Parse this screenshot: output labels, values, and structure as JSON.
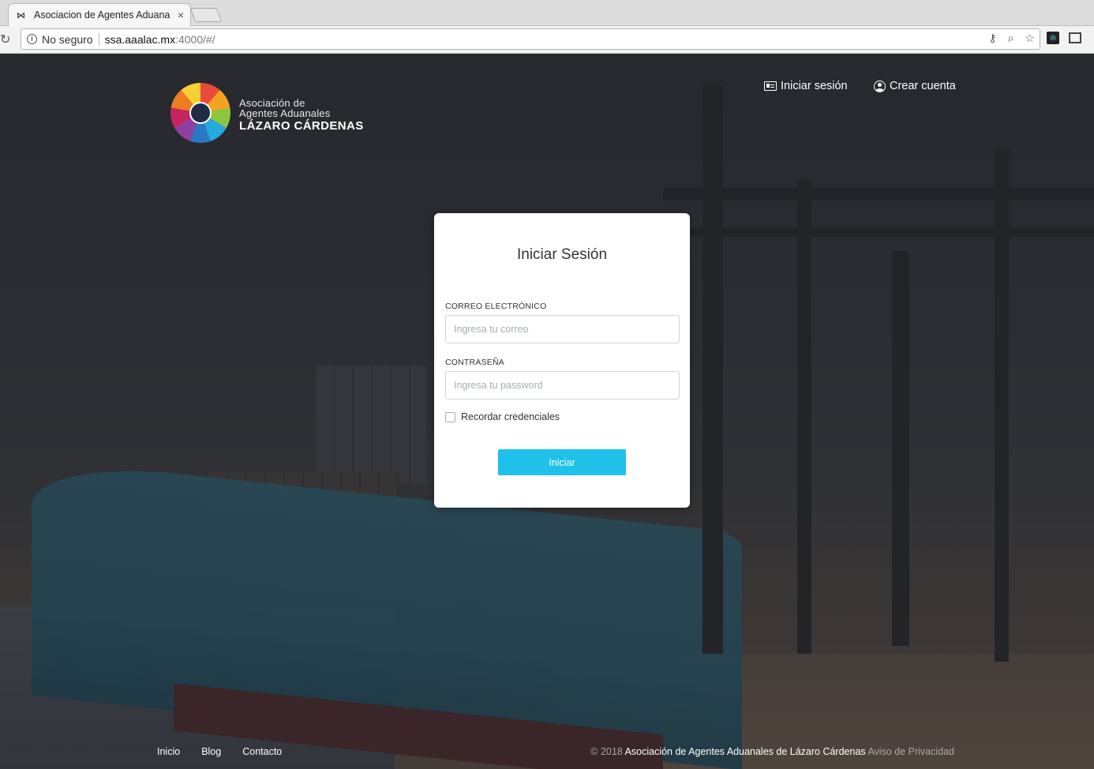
{
  "browser": {
    "tab_title": "Asociacion de Agentes Aduana",
    "tab_favicon": "bowtie-icon",
    "security_label": "No seguro",
    "url_host": "ssa.aaalac.mx",
    "url_rest": ":4000/#/"
  },
  "header": {
    "logo_line1": "Asociación de",
    "logo_line2": "Agentes Aduanales",
    "logo_line3": "LÁZARO CÁRDENAS",
    "login_label": "Iniciar sesión",
    "signup_label": "Crear cuenta"
  },
  "login": {
    "title": "Iniciar Sesión",
    "email_label": "CORREO ELECTRÓNICO",
    "email_placeholder": "Ingresa tu correo",
    "email_value": "",
    "password_label": "CONTRASEÑA",
    "password_placeholder": "Ingresa tu password",
    "password_value": "",
    "remember_label": "Recordar credenciales",
    "remember_checked": false,
    "submit_label": "Iniciar"
  },
  "footer": {
    "links": [
      "Inicio",
      "Blog",
      "Contacto"
    ],
    "copyright": "© 2018",
    "organization": "Asociación de Agentes Aduanales de Lázaro Cárdenas",
    "privacy_label": "Aviso de Privacidad"
  },
  "colors": {
    "accent": "#1fc1ea",
    "card_bg": "#ffffff",
    "background": "#2b2d31"
  }
}
